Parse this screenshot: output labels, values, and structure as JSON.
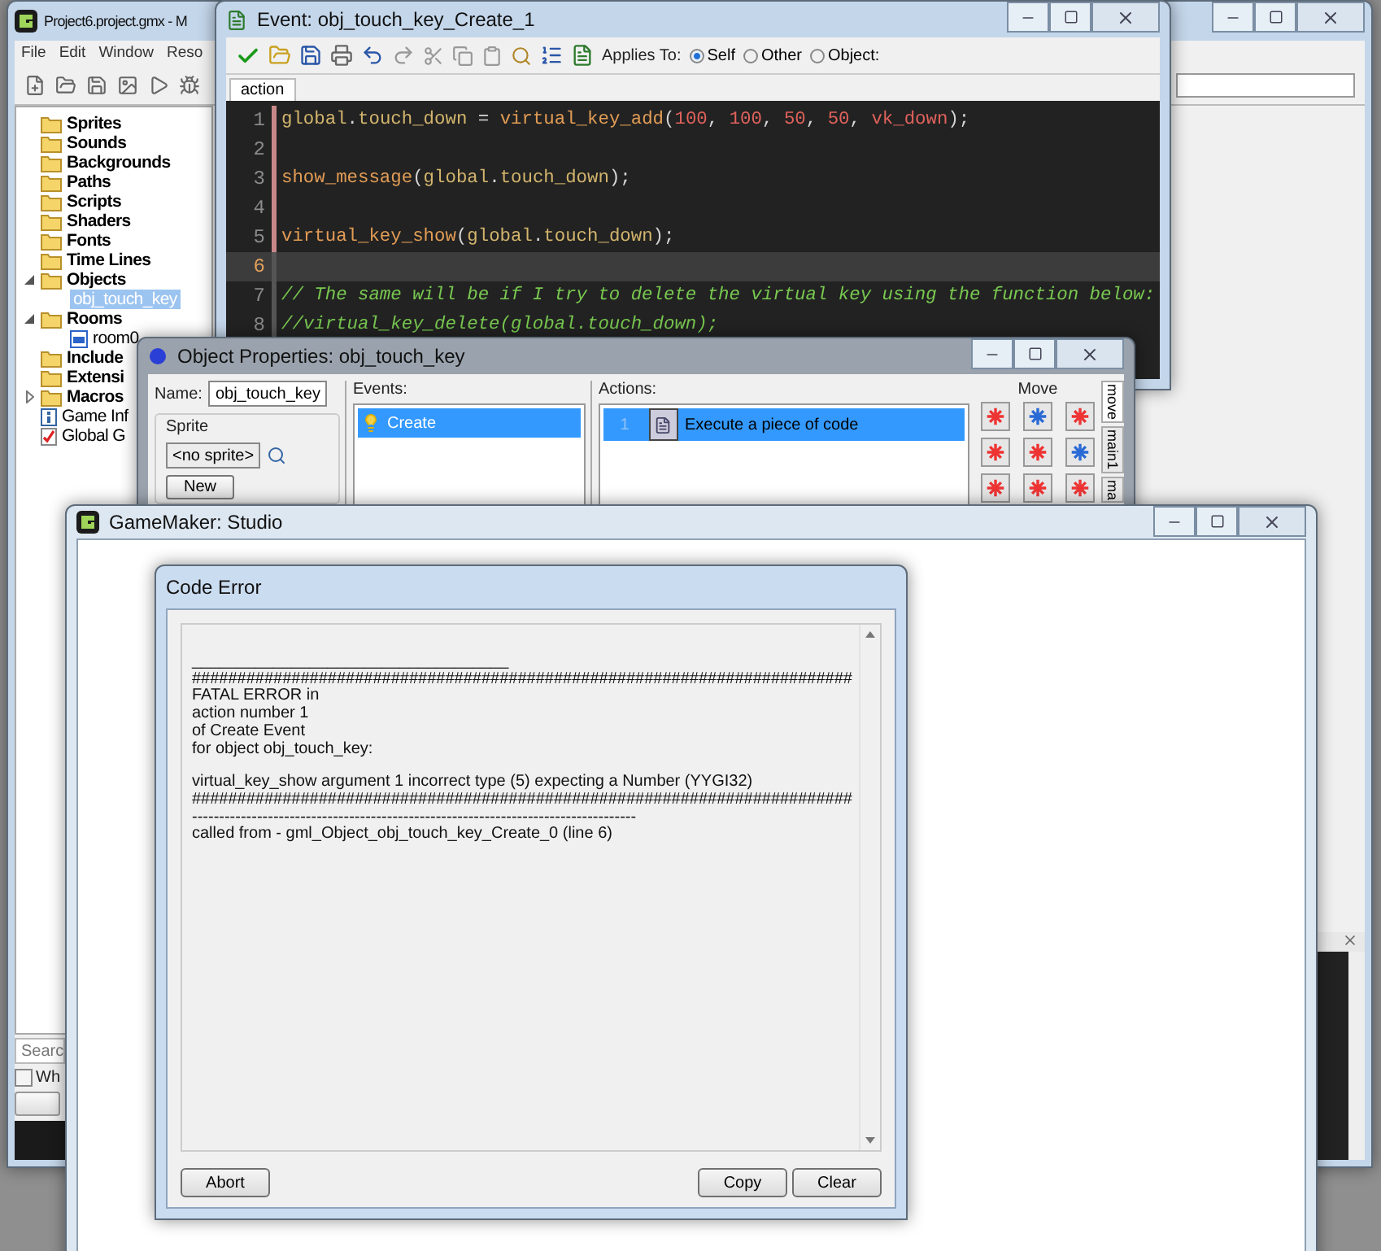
{
  "main_window": {
    "title": "Project6.project.gmx - M",
    "menu": [
      "File",
      "Edit",
      "Window",
      "Reso"
    ],
    "tree": [
      {
        "label": "Sprites",
        "kind": "folder"
      },
      {
        "label": "Sounds",
        "kind": "folder"
      },
      {
        "label": "Backgrounds",
        "kind": "folder"
      },
      {
        "label": "Paths",
        "kind": "folder"
      },
      {
        "label": "Scripts",
        "kind": "folder"
      },
      {
        "label": "Shaders",
        "kind": "folder"
      },
      {
        "label": "Fonts",
        "kind": "folder"
      },
      {
        "label": "Time Lines",
        "kind": "folder"
      },
      {
        "label": "Objects",
        "kind": "folder",
        "expanded": true,
        "children": [
          {
            "label": "obj_touch_key",
            "kind": "object",
            "selected": true
          }
        ]
      },
      {
        "label": "Rooms",
        "kind": "folder",
        "expanded": true,
        "children": [
          {
            "label": "room0",
            "kind": "room",
            "selected": false
          }
        ]
      },
      {
        "label": "Include",
        "kind": "folder"
      },
      {
        "label": "Extensi",
        "kind": "folder"
      },
      {
        "label": "Macros",
        "kind": "folder",
        "expanded": false
      },
      {
        "label": "Game Inf",
        "kind": "info"
      },
      {
        "label": "Global G",
        "kind": "settings"
      }
    ],
    "search_label": "Searc",
    "checkbox": {
      "label": "Wh",
      "checked": false
    }
  },
  "event_window": {
    "title": "Event: obj_touch_key_Create_1",
    "applies_to_label": "Applies To:",
    "applies_to": [
      {
        "label": "Self",
        "selected": true
      },
      {
        "label": "Other",
        "selected": false
      },
      {
        "label": "Object:",
        "selected": false
      }
    ],
    "tab": "action",
    "code": [
      {
        "number": "1",
        "modified": true,
        "current": false,
        "tokens": [
          {
            "text": "global",
            "kind": "var"
          },
          {
            "text": ".",
            "kind": "punct"
          },
          {
            "text": "touch_down",
            "kind": "var"
          },
          {
            "text": " = ",
            "kind": "punct"
          },
          {
            "text": "virtual_key_add",
            "kind": "func"
          },
          {
            "text": "(",
            "kind": "punct"
          },
          {
            "text": "100",
            "kind": "num"
          },
          {
            "text": ", ",
            "kind": "punct"
          },
          {
            "text": "100",
            "kind": "num"
          },
          {
            "text": ", ",
            "kind": "punct"
          },
          {
            "text": "50",
            "kind": "num"
          },
          {
            "text": ", ",
            "kind": "punct"
          },
          {
            "text": "50",
            "kind": "num"
          },
          {
            "text": ", ",
            "kind": "punct"
          },
          {
            "text": "vk_down",
            "kind": "num"
          },
          {
            "text": ");",
            "kind": "punct"
          }
        ]
      },
      {
        "number": "2",
        "modified": true,
        "current": false
      },
      {
        "number": "3",
        "modified": true,
        "current": false,
        "tokens": [
          {
            "text": "show_message",
            "kind": "func"
          },
          {
            "text": "(",
            "kind": "punct"
          },
          {
            "text": "global",
            "kind": "var"
          },
          {
            "text": ".",
            "kind": "punct"
          },
          {
            "text": "touch_down",
            "kind": "var"
          },
          {
            "text": ");",
            "kind": "punct"
          }
        ]
      },
      {
        "number": "4",
        "modified": true,
        "current": false
      },
      {
        "number": "5",
        "modified": true,
        "current": false,
        "tokens": [
          {
            "text": "virtual_key_show",
            "kind": "func"
          },
          {
            "text": "(",
            "kind": "punct"
          },
          {
            "text": "global",
            "kind": "var"
          },
          {
            "text": ".",
            "kind": "punct"
          },
          {
            "text": "touch_down",
            "kind": "var"
          },
          {
            "text": ");",
            "kind": "punct"
          }
        ]
      },
      {
        "number": "6",
        "modified": false,
        "current": true
      },
      {
        "number": "7",
        "modified": false,
        "current": false,
        "tokens": [
          {
            "text": "// The same will be if I try to delete the virtual key using the function below:",
            "kind": "comment"
          }
        ]
      },
      {
        "number": "8",
        "modified": false,
        "current": false,
        "tokens": [
          {
            "text": "//virtual_key_delete(global.touch_down);",
            "kind": "comment"
          }
        ]
      }
    ]
  },
  "object_properties": {
    "title": "Object Properties: obj_touch_key",
    "name_label": "Name:",
    "name_value": "obj_touch_key",
    "sprite_label": "Sprite",
    "sprite_value": "<no sprite>",
    "new_button": "New",
    "events_label": "Events:",
    "events": [
      {
        "label": "Create",
        "selected": true
      }
    ],
    "actions_label": "Actions:",
    "actions": [
      {
        "number": "1",
        "label": "Execute a piece of code",
        "selected": true
      }
    ],
    "palette_label": "Move",
    "palette_tabs": [
      {
        "label": "move",
        "selected": true
      },
      {
        "label": "main1",
        "selected": false
      },
      {
        "label": "ma",
        "selected": false
      }
    ]
  },
  "gm_window": {
    "title": "GameMaker: Studio"
  },
  "error_dialog": {
    "title": "Code Error",
    "paragraphs": [
      [
        "___________________________________",
        "#########################################################################",
        "FATAL ERROR in",
        "action number 1",
        "of Create Event",
        "for object obj_touch_key:"
      ],
      [
        "virtual_key_show argument 1 incorrect type (5) expecting a Number (YYGI32)",
        "#########################################################################",
        "----------------------------------------------------------------------------------",
        "called from - gml_Object_obj_touch_key_Create_0 (line 6)"
      ]
    ],
    "left_buttons": [
      "Abort"
    ],
    "right_buttons": [
      "Copy",
      "Clear"
    ]
  }
}
